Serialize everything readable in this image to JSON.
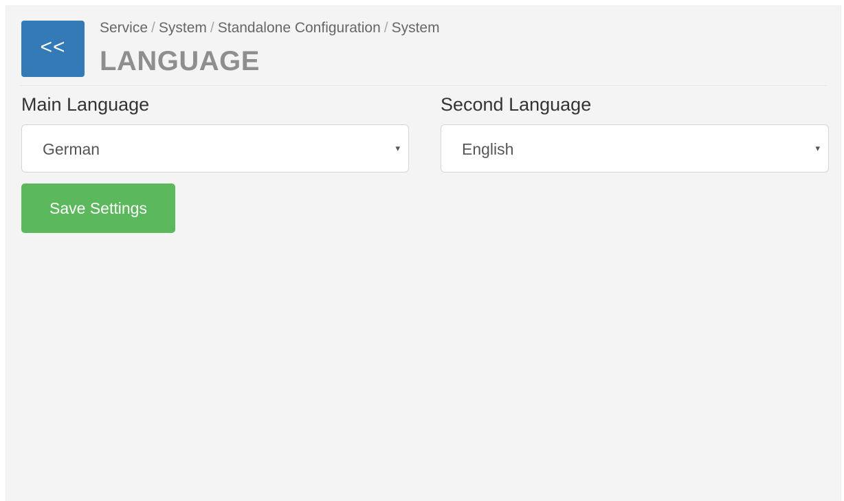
{
  "header": {
    "back_label": "<<",
    "breadcrumb": [
      "Service",
      "System",
      "Standalone Configuration",
      "System"
    ],
    "breadcrumb_separator": "/",
    "title": "LANGUAGE"
  },
  "form": {
    "main_language": {
      "label": "Main Language",
      "selected": "German"
    },
    "second_language": {
      "label": "Second Language",
      "selected": "English"
    },
    "caret_glyph": "▾",
    "save_label": "Save Settings"
  },
  "colors": {
    "back_button": "#337ab7",
    "save_button": "#5cb85c",
    "title": "#8e8e8e",
    "panel_background": "#f4f4f4"
  },
  "icons": {
    "dropdown_indicator": "caret-down-icon"
  }
}
